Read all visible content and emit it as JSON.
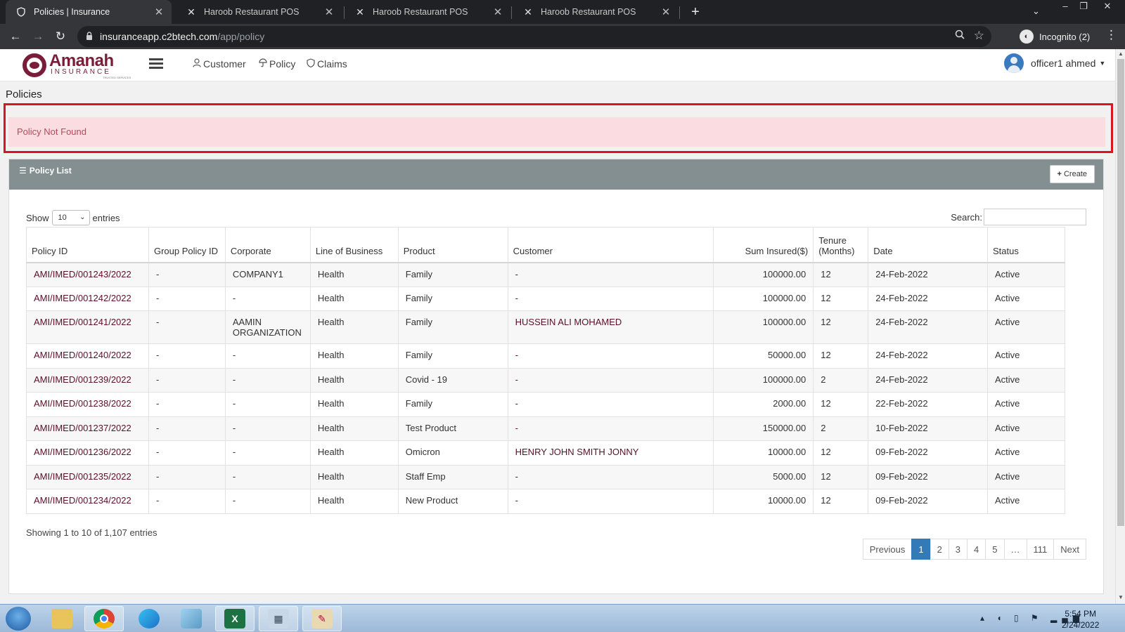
{
  "browser": {
    "tabs": [
      {
        "title": "Policies | Insurance",
        "active": true,
        "icon": "shield-icon"
      },
      {
        "title": "Haroob Restaurant POS",
        "active": false,
        "icon": "x-logo-icon"
      },
      {
        "title": "Haroob Restaurant POS",
        "active": false,
        "icon": "x-logo-icon"
      },
      {
        "title": "Haroob Restaurant POS",
        "active": false,
        "icon": "x-logo-icon"
      }
    ],
    "url_host": "insuranceapp.c2btech.com",
    "url_path": "/app/policy",
    "incognito_label": "Incognito (2)"
  },
  "app": {
    "logo_text": "Amanah",
    "logo_sub": "INSURANCE",
    "logo_tagline": "TRUSTED SERVICES",
    "nav": [
      {
        "label": "Customer",
        "icon": "user-icon"
      },
      {
        "label": "Policy",
        "icon": "umbrella-icon"
      },
      {
        "label": "Claims",
        "icon": "shield-icon"
      }
    ],
    "user_name": "officer1 ahmed"
  },
  "page": {
    "title": "Policies",
    "alert": "Policy Not Found",
    "panel_title": "Policy List",
    "create_label": "Create",
    "show_label": "Show",
    "entries_value": "10",
    "entries_label": "entries",
    "search_label": "Search:",
    "search_value": ""
  },
  "table": {
    "columns": [
      "Policy ID",
      "Group Policy ID",
      "Corporate",
      "Line of Business",
      "Product",
      "Customer",
      "Sum Insured($)",
      "Tenure (Months)",
      "Date",
      "Status"
    ],
    "rows": [
      {
        "policy_id": "AMI/IMED/001243/2022",
        "group": "-",
        "corporate": "COMPANY1",
        "lob": "Health",
        "product": "Family",
        "customer": "-",
        "sum": "100000.00",
        "tenure": "12",
        "date": "24-Feb-2022",
        "status": "Active"
      },
      {
        "policy_id": "AMI/IMED/001242/2022",
        "group": "-",
        "corporate": "-",
        "lob": "Health",
        "product": "Family",
        "customer": "-",
        "sum": "100000.00",
        "tenure": "12",
        "date": "24-Feb-2022",
        "status": "Active"
      },
      {
        "policy_id": "AMI/IMED/001241/2022",
        "group": "-",
        "corporate": "AAMIN ORGANIZATION",
        "lob": "Health",
        "product": "Family",
        "customer": "HUSSEIN ALI MOHAMED",
        "sum": "100000.00",
        "tenure": "12",
        "date": "24-Feb-2022",
        "status": "Active"
      },
      {
        "policy_id": "AMI/IMED/001240/2022",
        "group": "-",
        "corporate": "-",
        "lob": "Health",
        "product": "Family",
        "customer": "-",
        "sum": "50000.00",
        "tenure": "12",
        "date": "24-Feb-2022",
        "status": "Active"
      },
      {
        "policy_id": "AMI/IMED/001239/2022",
        "group": "-",
        "corporate": "-",
        "lob": "Health",
        "product": "Covid - 19",
        "customer": "-",
        "sum": "100000.00",
        "tenure": "2",
        "date": "24-Feb-2022",
        "status": "Active"
      },
      {
        "policy_id": "AMI/IMED/001238/2022",
        "group": "-",
        "corporate": "-",
        "lob": "Health",
        "product": "Family",
        "customer": "-",
        "sum": "2000.00",
        "tenure": "12",
        "date": "22-Feb-2022",
        "status": "Active"
      },
      {
        "policy_id": "AMI/IMED/001237/2022",
        "group": "-",
        "corporate": "-",
        "lob": "Health",
        "product": "Test Product",
        "customer": "-",
        "sum": "150000.00",
        "tenure": "2",
        "date": "10-Feb-2022",
        "status": "Active"
      },
      {
        "policy_id": "AMI/IMED/001236/2022",
        "group": "-",
        "corporate": "-",
        "lob": "Health",
        "product": "Omicron",
        "customer": "HENRY JOHN SMITH JONNY",
        "sum": "10000.00",
        "tenure": "12",
        "date": "09-Feb-2022",
        "status": "Active"
      },
      {
        "policy_id": "AMI/IMED/001235/2022",
        "group": "-",
        "corporate": "-",
        "lob": "Health",
        "product": "Staff Emp",
        "customer": "-",
        "sum": "5000.00",
        "tenure": "12",
        "date": "09-Feb-2022",
        "status": "Active"
      },
      {
        "policy_id": "AMI/IMED/001234/2022",
        "group": "-",
        "corporate": "-",
        "lob": "Health",
        "product": "New Product",
        "customer": "-",
        "sum": "10000.00",
        "tenure": "12",
        "date": "09-Feb-2022",
        "status": "Active"
      }
    ],
    "info": "Showing 1 to 10 of 1,107 entries"
  },
  "pagination": {
    "previous": "Previous",
    "pages": [
      "1",
      "2",
      "3",
      "4",
      "5",
      "…",
      "111"
    ],
    "current": "1",
    "next": "Next"
  },
  "taskbar": {
    "time": "5:54 PM",
    "date": "2/24/2022",
    "apps": [
      "file-explorer-icon",
      "chrome-icon",
      "edge-icon",
      "notepad-icon",
      "excel-icon",
      "calculator-icon",
      "paint-icon"
    ]
  },
  "colors": {
    "brand": "#7a1d3a",
    "alert_bg": "#fbdde1",
    "alert_text": "#b24a5a",
    "panel_header": "#838f91",
    "page_active": "#337ab7",
    "highlight_frame": "#d9161f"
  }
}
